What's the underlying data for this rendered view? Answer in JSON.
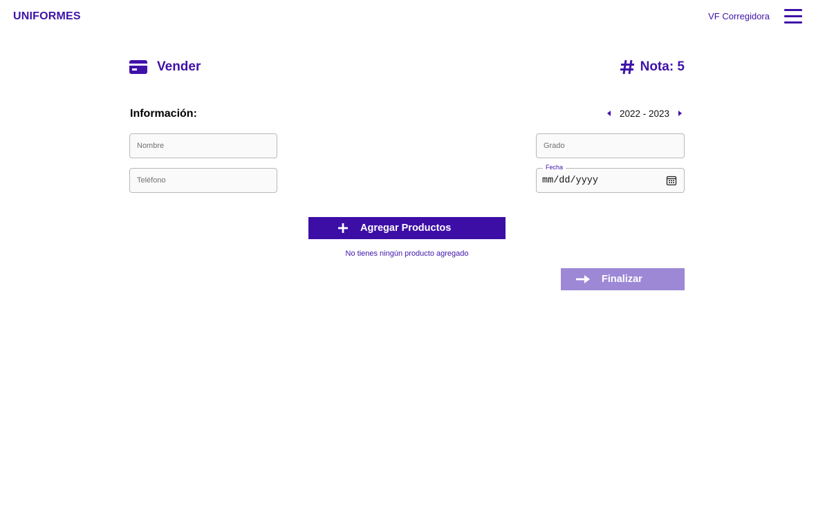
{
  "header": {
    "brand": "UNIFORMES",
    "store_name": "VF Corregidora",
    "menu_icon": "hamburger-menu-icon"
  },
  "page": {
    "title": "Vender",
    "title_icon": "credit-card-icon",
    "nota_label": "Nota: 5",
    "nota_icon": "hash-icon"
  },
  "info": {
    "section_label": "Información:",
    "school_year": "2022 - 2023",
    "prev_icon": "caret-left-icon",
    "next_icon": "caret-right-icon"
  },
  "form": {
    "nombre_placeholder": "Nombre",
    "telefono_placeholder": "Teléfono",
    "grado_placeholder": "Grado",
    "fecha_label": "Fecha",
    "fecha_value": "mm/dd/yyyy",
    "calendar_icon": "calendar-icon"
  },
  "actions": {
    "add_products_label": "Agregar Productos",
    "add_icon": "plus-icon",
    "empty_message": "No tienes ningún producto agregado",
    "finish_label": "Finalizar",
    "finish_icon": "arrow-right-icon"
  },
  "colors": {
    "primary": "#3c0ea6",
    "primary_text": "#3f12a8",
    "disabled_button": "#9d88d6"
  }
}
